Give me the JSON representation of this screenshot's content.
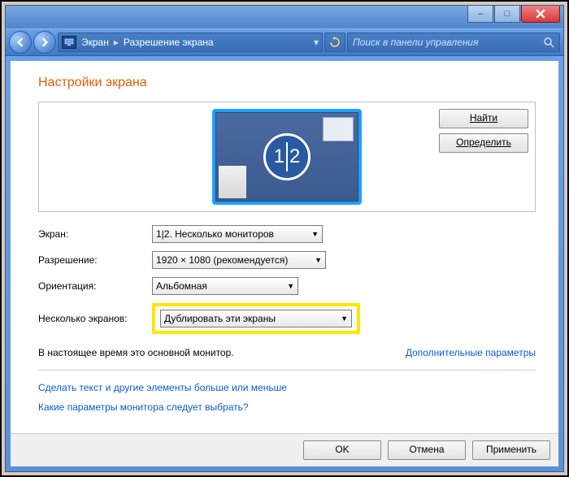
{
  "titlebar": {
    "minimize": "–",
    "maximize": "□",
    "close": "X"
  },
  "nav": {
    "crumb1": "Экран",
    "crumb2": "Разрешение экрана",
    "search_placeholder": "Поиск в панели управления"
  },
  "page": {
    "title": "Настройки экрана",
    "find_btn": "Найти",
    "detect_btn": "Определить",
    "badge_1": "1",
    "badge_2": "2"
  },
  "form": {
    "screen_label": "Экран:",
    "screen_value": "1|2. Несколько мониторов",
    "res_label": "Разрешение:",
    "res_value": "1920 × 1080 (рекомендуется)",
    "orient_label": "Ориентация:",
    "orient_value": "Альбомная",
    "multi_label": "Несколько экранов:",
    "multi_value": "Дублировать эти экраны"
  },
  "notes": {
    "primary": "В настоящее время это основной монитор.",
    "adv": "Дополнительные параметры",
    "link1": "Сделать текст и другие элементы больше или меньше",
    "link2": "Какие параметры монитора следует выбрать?"
  },
  "footer": {
    "ok": "OK",
    "cancel": "Отмена",
    "apply": "Применить"
  }
}
